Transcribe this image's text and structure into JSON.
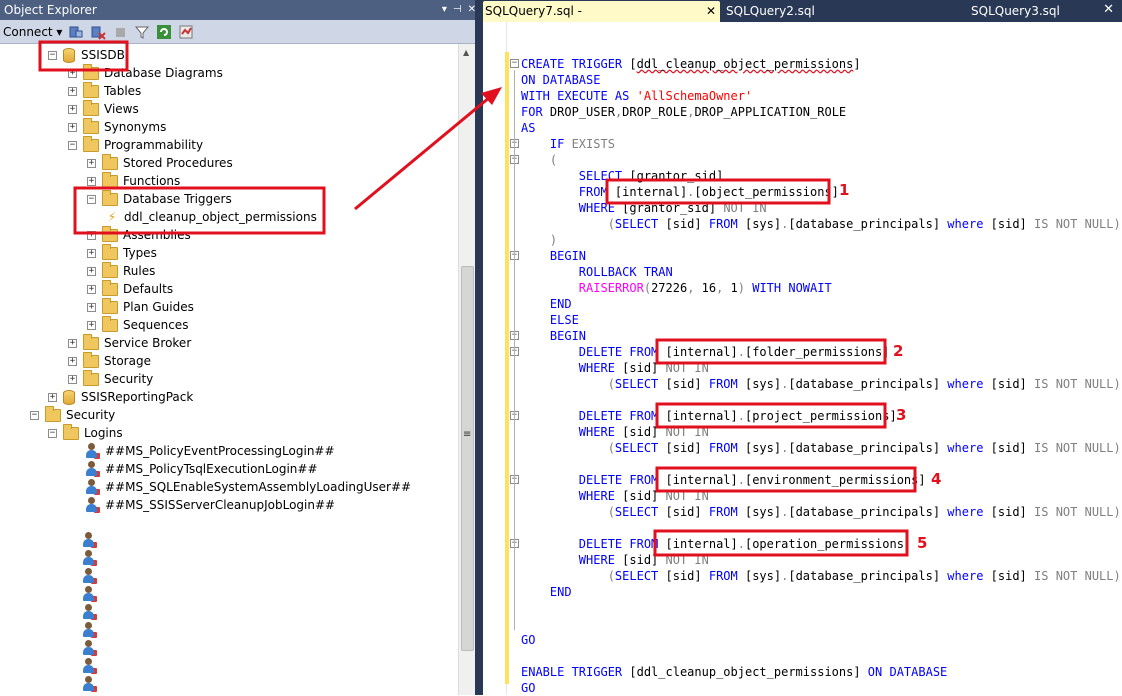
{
  "object_explorer": {
    "title": "Object Explorer",
    "title_buttons": [
      "▾",
      "⊣",
      "✕"
    ],
    "connect_label": "Connect ▾",
    "tree": [
      {
        "label": "SSISDB",
        "icon": "database-icon",
        "expander": "−"
      },
      {
        "label": "Database Diagrams",
        "icon": "folder-icon",
        "expander": "+"
      },
      {
        "label": "Tables",
        "icon": "folder-icon",
        "expander": "+"
      },
      {
        "label": "Views",
        "icon": "folder-icon",
        "expander": "+"
      },
      {
        "label": "Synonyms",
        "icon": "folder-icon",
        "expander": "+"
      },
      {
        "label": "Programmability",
        "icon": "folder-icon",
        "expander": "−"
      },
      {
        "label": "Stored Procedures",
        "icon": "folder-icon",
        "expander": "+"
      },
      {
        "label": "Functions",
        "icon": "folder-icon",
        "expander": "+"
      },
      {
        "label": "Database Triggers",
        "icon": "folder-icon",
        "expander": "−"
      },
      {
        "label": "ddl_cleanup_object_permissions",
        "icon": "trigger-icon",
        "expander": ""
      },
      {
        "label": "Assemblies",
        "icon": "folder-icon",
        "expander": "+"
      },
      {
        "label": "Types",
        "icon": "folder-icon",
        "expander": "+"
      },
      {
        "label": "Rules",
        "icon": "folder-icon",
        "expander": "+"
      },
      {
        "label": "Defaults",
        "icon": "folder-icon",
        "expander": "+"
      },
      {
        "label": "Plan Guides",
        "icon": "folder-icon",
        "expander": "+"
      },
      {
        "label": "Sequences",
        "icon": "folder-icon",
        "expander": "+"
      },
      {
        "label": "Service Broker",
        "icon": "folder-icon",
        "expander": "+"
      },
      {
        "label": "Storage",
        "icon": "folder-icon",
        "expander": "+"
      },
      {
        "label": "Security",
        "icon": "folder-icon",
        "expander": "+"
      },
      {
        "label": "SSISReportingPack",
        "icon": "database-icon",
        "expander": "+"
      },
      {
        "label": "Security",
        "icon": "folder-icon",
        "expander": "−"
      },
      {
        "label": "Logins",
        "icon": "folder-icon",
        "expander": "−"
      },
      {
        "label": "##MS_PolicyEventProcessingLogin##",
        "icon": "login-icon",
        "expander": ""
      },
      {
        "label": "##MS_PolicyTsqlExecutionLogin##",
        "icon": "login-icon",
        "expander": ""
      },
      {
        "label": "##MS_SQLEnableSystemAssemblyLoadingUser##",
        "icon": "login-icon",
        "expander": ""
      },
      {
        "label": "##MS_SSISServerCleanupJobLogin##",
        "icon": "login-icon",
        "expander": ""
      }
    ]
  },
  "editor": {
    "tabs": [
      {
        "label": "SQLQuery7.sql -",
        "active": true,
        "close": "✕"
      },
      {
        "label": "SQLQuery2.sql",
        "active": false
      },
      {
        "label": "SQLQuery3.sql",
        "active": false
      }
    ],
    "window_close": "✕",
    "code_lines": [
      [
        [
          "kw",
          "CREATE TRIGGER "
        ],
        [
          "t",
          "["
        ],
        [
          "sq",
          "ddl_cleanup_object_permissions"
        ],
        [
          "t",
          "]"
        ]
      ],
      [
        [
          "kw",
          "ON DATABASE"
        ]
      ],
      [
        [
          "kw",
          "WITH EXECUTE AS "
        ],
        [
          "str",
          "'AllSchemaOwner'"
        ]
      ],
      [
        [
          "kw",
          "FOR "
        ],
        [
          "t",
          "DROP_USER"
        ],
        [
          "gr",
          ","
        ],
        [
          "t",
          "DROP_ROLE"
        ],
        [
          "gr",
          ","
        ],
        [
          "t",
          "DROP_APPLICATION_ROLE"
        ]
      ],
      [
        [
          "kw",
          "AS"
        ]
      ],
      [
        [
          "kw",
          "    IF "
        ],
        [
          "gr",
          "EXISTS"
        ]
      ],
      [
        [
          "gr",
          "    ("
        ]
      ],
      [
        [
          "kw",
          "        SELECT "
        ],
        [
          "t",
          "[grantor_sid]"
        ]
      ],
      [
        [
          "kw",
          "        FROM "
        ],
        [
          "t",
          "[internal]"
        ],
        [
          "gr",
          "."
        ],
        [
          "t",
          "[object_permissions]"
        ]
      ],
      [
        [
          "kw",
          "        WHERE "
        ],
        [
          "t",
          "[grantor_sid] "
        ],
        [
          "gr",
          "NOT IN"
        ]
      ],
      [
        [
          "gr",
          "            ("
        ],
        [
          "kw",
          "SELECT "
        ],
        [
          "t",
          "[sid] "
        ],
        [
          "kw",
          "FROM "
        ],
        [
          "t",
          "[sys]"
        ],
        [
          "gr",
          "."
        ],
        [
          "t",
          "[database_principals] "
        ],
        [
          "kw",
          "where "
        ],
        [
          "t",
          "[sid] "
        ],
        [
          "gr",
          "IS NOT NULL)"
        ]
      ],
      [
        [
          "gr",
          "    )"
        ]
      ],
      [
        [
          "kw",
          "    BEGIN"
        ]
      ],
      [
        [
          "kw",
          "        ROLLBACK TRAN"
        ]
      ],
      [
        [
          "fn",
          "        RAISERROR"
        ],
        [
          "gr",
          "("
        ],
        [
          "t",
          "27226"
        ],
        [
          "gr",
          ", "
        ],
        [
          "t",
          "16"
        ],
        [
          "gr",
          ", "
        ],
        [
          "t",
          "1"
        ],
        [
          "gr",
          ") "
        ],
        [
          "kw",
          "WITH NOWAIT"
        ]
      ],
      [
        [
          "kw",
          "    END"
        ]
      ],
      [
        [
          "kw",
          "    ELSE"
        ]
      ],
      [
        [
          "kw",
          "    BEGIN"
        ]
      ],
      [
        [
          "kw",
          "        DELETE FROM "
        ],
        [
          "t",
          "[internal]"
        ],
        [
          "gr",
          "."
        ],
        [
          "t",
          "[folder_permissions]"
        ]
      ],
      [
        [
          "kw",
          "        WHERE "
        ],
        [
          "t",
          "[sid] "
        ],
        [
          "gr",
          "NOT IN"
        ]
      ],
      [
        [
          "gr",
          "            ("
        ],
        [
          "kw",
          "SELECT "
        ],
        [
          "t",
          "[sid] "
        ],
        [
          "kw",
          "FROM "
        ],
        [
          "t",
          "[sys]"
        ],
        [
          "gr",
          "."
        ],
        [
          "t",
          "[database_principals] "
        ],
        [
          "kw",
          "where "
        ],
        [
          "t",
          "[sid] "
        ],
        [
          "gr",
          "IS NOT NULL)"
        ]
      ],
      [
        [
          "t",
          ""
        ]
      ],
      [
        [
          "kw",
          "        DELETE FROM "
        ],
        [
          "t",
          "[internal]"
        ],
        [
          "gr",
          "."
        ],
        [
          "t",
          "[project_permissions]"
        ]
      ],
      [
        [
          "kw",
          "        WHERE "
        ],
        [
          "t",
          "[sid] "
        ],
        [
          "gr",
          "NOT IN"
        ]
      ],
      [
        [
          "gr",
          "            ("
        ],
        [
          "kw",
          "SELECT "
        ],
        [
          "t",
          "[sid] "
        ],
        [
          "kw",
          "FROM "
        ],
        [
          "t",
          "[sys]"
        ],
        [
          "gr",
          "."
        ],
        [
          "t",
          "[database_principals] "
        ],
        [
          "kw",
          "where "
        ],
        [
          "t",
          "[sid] "
        ],
        [
          "gr",
          "IS NOT NULL)"
        ]
      ],
      [
        [
          "t",
          ""
        ]
      ],
      [
        [
          "kw",
          "        DELETE FROM "
        ],
        [
          "t",
          "[internal]"
        ],
        [
          "gr",
          "."
        ],
        [
          "t",
          "[environment_permissions]"
        ]
      ],
      [
        [
          "kw",
          "        WHERE "
        ],
        [
          "t",
          "[sid] "
        ],
        [
          "gr",
          "NOT IN"
        ]
      ],
      [
        [
          "gr",
          "            ("
        ],
        [
          "kw",
          "SELECT "
        ],
        [
          "t",
          "[sid] "
        ],
        [
          "kw",
          "FROM "
        ],
        [
          "t",
          "[sys]"
        ],
        [
          "gr",
          "."
        ],
        [
          "t",
          "[database_principals] "
        ],
        [
          "kw",
          "where "
        ],
        [
          "t",
          "[sid] "
        ],
        [
          "gr",
          "IS NOT NULL)"
        ]
      ],
      [
        [
          "t",
          ""
        ]
      ],
      [
        [
          "kw",
          "        DELETE FROM "
        ],
        [
          "t",
          "[internal]"
        ],
        [
          "gr",
          "."
        ],
        [
          "t",
          "[operation_permissions]"
        ]
      ],
      [
        [
          "kw",
          "        WHERE "
        ],
        [
          "t",
          "[sid] "
        ],
        [
          "gr",
          "NOT IN"
        ]
      ],
      [
        [
          "gr",
          "            ("
        ],
        [
          "kw",
          "SELECT "
        ],
        [
          "t",
          "[sid] "
        ],
        [
          "kw",
          "FROM "
        ],
        [
          "t",
          "[sys]"
        ],
        [
          "gr",
          "."
        ],
        [
          "t",
          "[database_principals] "
        ],
        [
          "kw",
          "where "
        ],
        [
          "t",
          "[sid] "
        ],
        [
          "gr",
          "IS NOT NULL)"
        ]
      ],
      [
        [
          "kw",
          "    END"
        ]
      ],
      [
        [
          "t",
          ""
        ]
      ],
      [
        [
          "t",
          ""
        ]
      ],
      [
        [
          "kw",
          "GO"
        ]
      ],
      [
        [
          "t",
          ""
        ]
      ],
      [
        [
          "kw",
          "ENABLE TRIGGER "
        ],
        [
          "t",
          "[ddl_cleanup_object_permissions] "
        ],
        [
          "kw",
          "ON DATABASE"
        ]
      ],
      [
        [
          "kw",
          "GO"
        ]
      ]
    ],
    "callouts": [
      "1",
      "2",
      "3",
      "4",
      "5"
    ]
  },
  "colors": {
    "highlight_red": "#e0101e",
    "keyword_blue": "#0000ff",
    "string_red": "#ff0000",
    "title_bar": "#4d6082"
  }
}
